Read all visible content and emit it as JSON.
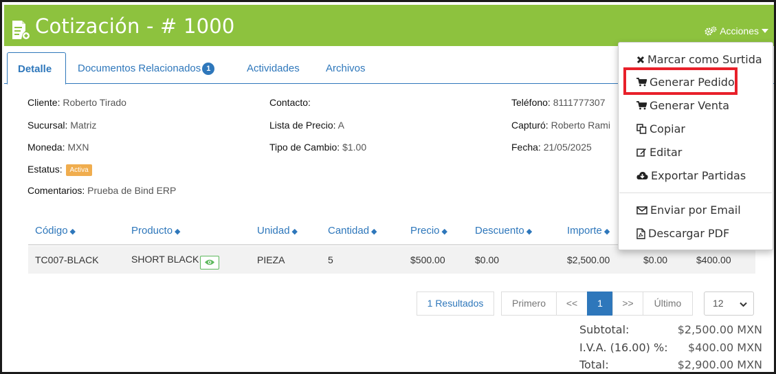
{
  "header": {
    "title": "Cotización - # 1000",
    "actions_label": "Acciones",
    "bg_color": "#8dc23e"
  },
  "tabs": [
    {
      "label": "Detalle",
      "active": true
    },
    {
      "label": "Documentos Relacionados",
      "badge": "1"
    },
    {
      "label": "Actividades"
    },
    {
      "label": "Archivos"
    }
  ],
  "info": {
    "cliente": {
      "label": "Cliente:",
      "value": "Roberto Tirado"
    },
    "sucursal": {
      "label": "Sucursal:",
      "value": "Matriz"
    },
    "moneda": {
      "label": "Moneda:",
      "value": "MXN"
    },
    "estatus": {
      "label": "Estatus:",
      "value": "Activa"
    },
    "comentarios": {
      "label": "Comentarios:",
      "value": "Prueba de Bind ERP"
    },
    "contacto": {
      "label": "Contacto:",
      "value": ""
    },
    "lista_precio": {
      "label": "Lista de Precio:",
      "value": "A"
    },
    "tipo_cambio": {
      "label": "Tipo de Cambio:",
      "value": "$1.00"
    },
    "telefono": {
      "label": "Teléfono:",
      "value": "8111777307"
    },
    "capturo": {
      "label": "Capturó:",
      "value": "Roberto Rami"
    },
    "fecha": {
      "label": "Fecha:",
      "value": "21/05/2025"
    }
  },
  "table": {
    "columns": [
      "Código",
      "Producto",
      "Unidad",
      "Cantidad",
      "Precio",
      "Descuento",
      "Importe"
    ],
    "rows": [
      {
        "codigo": "TC007-BLACK",
        "producto": "SHORT BLACK",
        "unidad": "PIEZA",
        "cantidad": "5",
        "precio": "$500.00",
        "descuento": "$0.00",
        "importe": "$2,500.00",
        "col8": "$0.00",
        "col9": "$400.00"
      }
    ]
  },
  "pagination": {
    "results": "1 Resultados",
    "first": "Primero",
    "prev": "<<",
    "current": "1",
    "next": ">>",
    "last": "Último",
    "page_size": "12"
  },
  "totals": {
    "subtotal_label": "Subtotal:",
    "subtotal_value": "$2,500.00 MXN",
    "iva_label": "I.V.A. (16.00) %:",
    "iva_value": "$400.00 MXN",
    "total_label": "Total:",
    "total_value": "$2,900.00 MXN"
  },
  "menu": {
    "items": [
      {
        "label": "Marcar como Surtida",
        "icon": "x-icon"
      },
      {
        "label": "Generar Pedido",
        "icon": "cart-icon"
      },
      {
        "label": "Generar Venta",
        "icon": "cart-icon"
      },
      {
        "label": "Copiar",
        "icon": "copy-icon"
      },
      {
        "label": "Editar",
        "icon": "edit-icon"
      },
      {
        "label": "Exportar Partidas",
        "icon": "cloud-download-icon"
      },
      {
        "label": "Enviar por Email",
        "icon": "envelope-icon"
      },
      {
        "label": "Descargar PDF",
        "icon": "pdf-icon"
      }
    ],
    "highlight_color": "#e8202a"
  },
  "colors": {
    "link": "#2e77bb",
    "status_badge": "#f0ad4e"
  }
}
